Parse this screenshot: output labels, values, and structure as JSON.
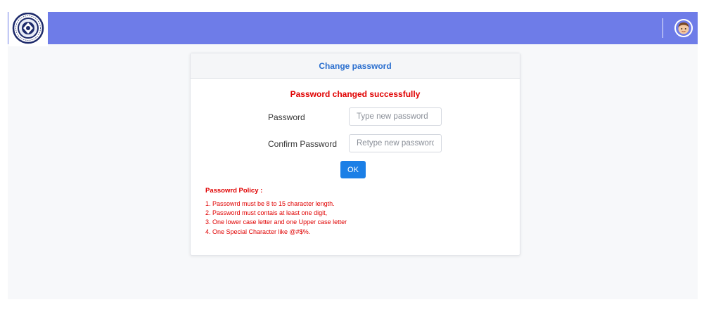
{
  "brand": {
    "logo_icon": "university-emblem-icon",
    "colors": {
      "topbar": "#6e7ce8",
      "accent": "#1b7fe6",
      "error_text": "#e00000",
      "header_text": "#2b6fcf"
    }
  },
  "header": {
    "avatar_icon": "user-avatar-icon"
  },
  "card": {
    "title": "Change password",
    "status_message": "Password changed successfully",
    "fields": {
      "password": {
        "label": "Password",
        "placeholder": "Type new password",
        "value": ""
      },
      "confirm": {
        "label": "Confirm Password",
        "placeholder": "Retype new password",
        "value": ""
      }
    },
    "ok_label": "OK",
    "policy": {
      "title": "Passowrd Policy :",
      "items": [
        "1. Passowrd must be 8 to 15 character length.",
        "2. Password must contais at least one digit,",
        "3. One lower case letter and one Upper case letter",
        "4. One Special Character like @#$%."
      ]
    }
  }
}
